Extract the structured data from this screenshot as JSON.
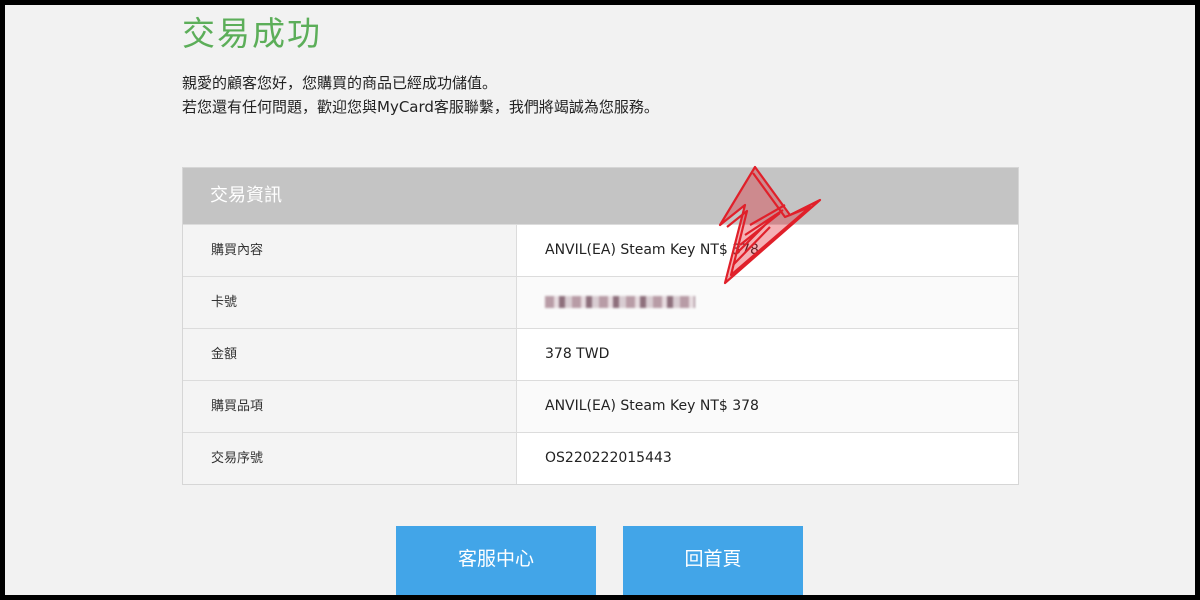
{
  "page": {
    "title": "交易成功",
    "message_line1": "親愛的顧客您好，您購買的商品已經成功儲值。",
    "message_line2": "若您還有任何問題，歡迎您與MyCard客服聯繫，我們將竭誠為您服務。"
  },
  "panel": {
    "header": "交易資訊",
    "rows": [
      {
        "label": "購買內容",
        "value": "ANVIL(EA) Steam Key NT$ 378"
      },
      {
        "label": "卡號",
        "value": ""
      },
      {
        "label": "金額",
        "value": "378 TWD"
      },
      {
        "label": "購買品項",
        "value": "ANVIL(EA) Steam Key NT$ 378"
      },
      {
        "label": "交易序號",
        "value": "OS220222015443"
      }
    ]
  },
  "buttons": {
    "service": "客服中心",
    "home": "回首頁"
  },
  "colors": {
    "title": "#5cae59",
    "header_bg": "#c4c4c4",
    "button_bg": "#42a5e8",
    "annotation_arrow": "#e0202a"
  }
}
